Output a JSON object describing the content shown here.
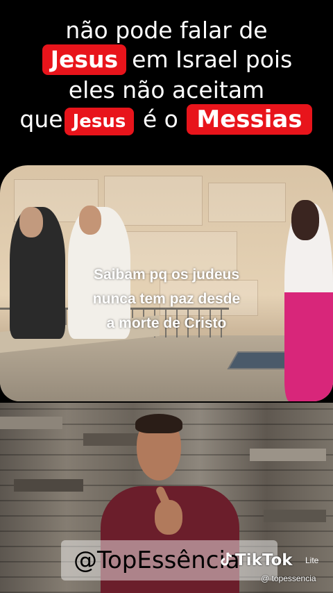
{
  "caption": {
    "line1": "não pode falar de",
    "line2_pill": "Jesus",
    "line2_rest": "em Israel pois",
    "line3": "eles não aceitam",
    "line4_pre": "que",
    "line4_pill": "Jesus",
    "line4_mid": "é o",
    "line4_pill2": "Messias"
  },
  "video": {
    "overlay_lines": [
      "Saibam pq os judeus",
      "nunca tem paz desde",
      "a morte de Cristo"
    ]
  },
  "watermark": {
    "text": "@TopEssência"
  },
  "tiktok": {
    "brand": "TikTok",
    "lite": "Lite",
    "handle": "@ topessencia"
  },
  "colors": {
    "accent_red": "#e8141b",
    "background": "#000000"
  }
}
